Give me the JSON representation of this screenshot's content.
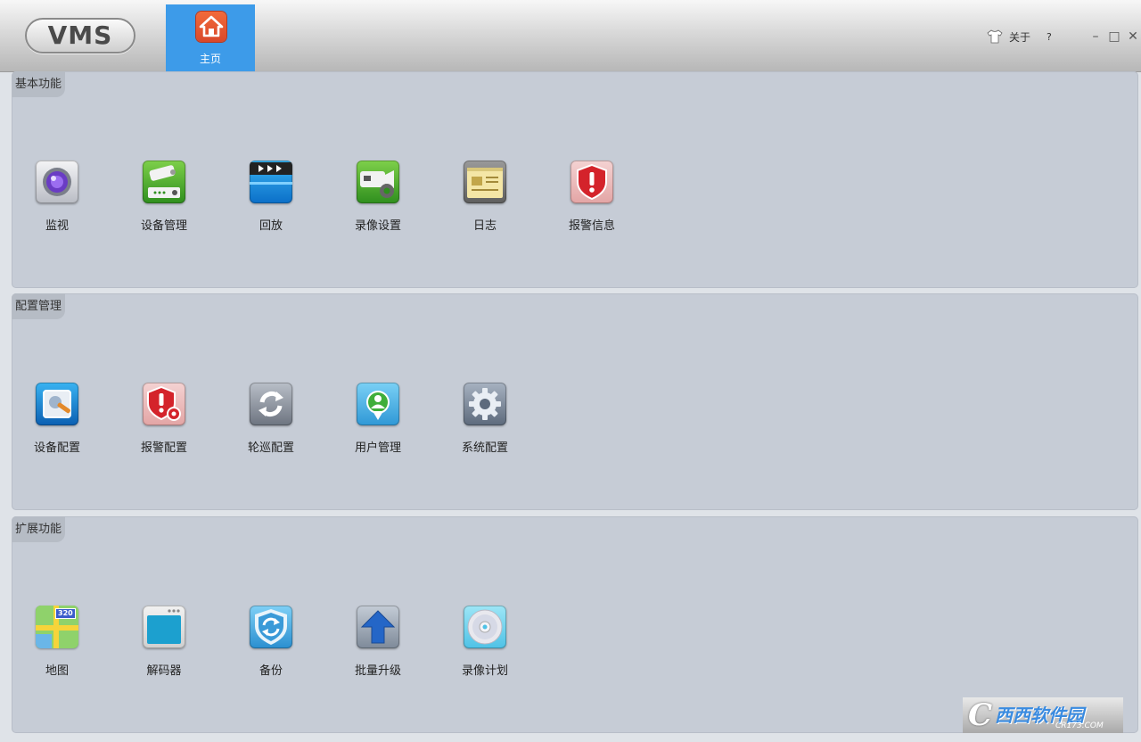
{
  "app": {
    "logo": "VMS"
  },
  "nav": {
    "home_label": "主页"
  },
  "topbar": {
    "about_label": "关于",
    "help_label": "?"
  },
  "window_controls": {
    "minimize": "–",
    "maximize": "□",
    "close": "✕"
  },
  "colors": {
    "active_tab": "#3d9be9",
    "section_bg": "#c6ccd6",
    "section_header_bg": "#b6bcc5"
  },
  "sections": [
    {
      "title": "基本功能",
      "items": [
        {
          "label": "监视",
          "icon": "camera-lens-icon"
        },
        {
          "label": "设备管理",
          "icon": "device-management-icon"
        },
        {
          "label": "回放",
          "icon": "playback-clapper-icon"
        },
        {
          "label": "录像设置",
          "icon": "record-settings-icon"
        },
        {
          "label": "日志",
          "icon": "log-notebook-icon"
        },
        {
          "label": "报警信息",
          "icon": "alarm-shield-icon"
        }
      ]
    },
    {
      "title": "配置管理",
      "items": [
        {
          "label": "设备配置",
          "icon": "device-config-icon"
        },
        {
          "label": "报警配置",
          "icon": "alarm-config-icon"
        },
        {
          "label": "轮巡配置",
          "icon": "patrol-cycle-icon"
        },
        {
          "label": "用户管理",
          "icon": "user-management-icon"
        },
        {
          "label": "系统配置",
          "icon": "system-gear-icon"
        }
      ]
    },
    {
      "title": "扩展功能",
      "items": [
        {
          "label": "地图",
          "icon": "map-icon",
          "badge": "320"
        },
        {
          "label": "解码器",
          "icon": "decoder-icon"
        },
        {
          "label": "备份",
          "icon": "backup-icon"
        },
        {
          "label": "批量升级",
          "icon": "batch-upgrade-arrow-icon"
        },
        {
          "label": "录像计划",
          "icon": "record-plan-disc-icon"
        }
      ]
    }
  ],
  "watermark": {
    "logo_letter": "C",
    "text": "西西软件园",
    "sub": "CR173.COM"
  }
}
